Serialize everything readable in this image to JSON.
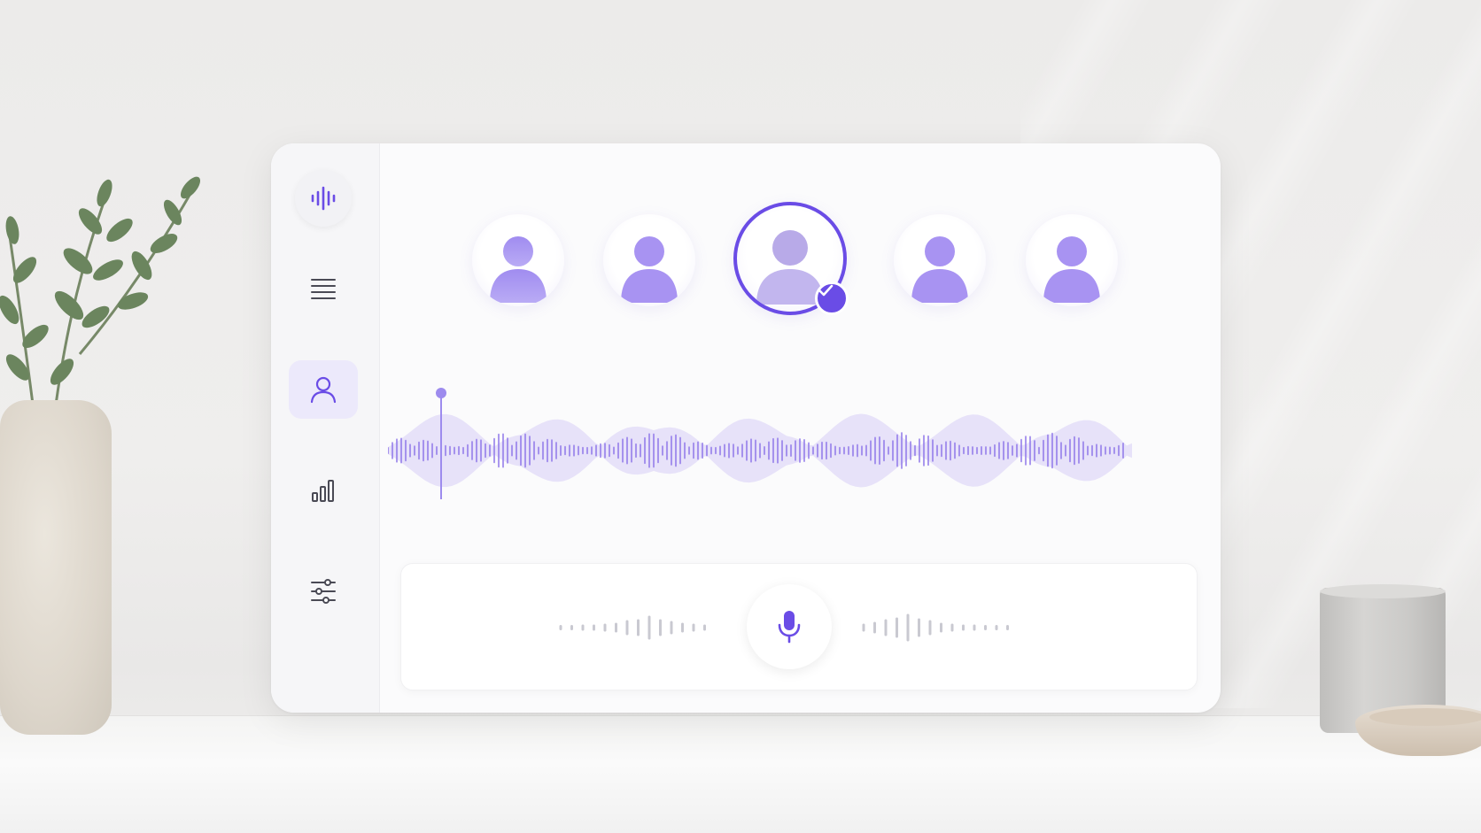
{
  "theme": {
    "accent": "#6a4ce6",
    "accent_light": "#a896f0",
    "icon_gray": "#4a4a55"
  },
  "sidebar": {
    "items": [
      {
        "name": "audio-waveform-logo",
        "icon": "waveform-icon",
        "active": false
      },
      {
        "name": "list",
        "icon": "menu-lines-icon",
        "active": false
      },
      {
        "name": "voices",
        "icon": "user-icon",
        "active": true
      },
      {
        "name": "analytics",
        "icon": "bar-chart-icon",
        "active": false
      },
      {
        "name": "settings",
        "icon": "sliders-icon",
        "active": false
      }
    ]
  },
  "voices": {
    "avatars": [
      {
        "icon": "person-icon",
        "selected": false
      },
      {
        "icon": "person-icon",
        "selected": false
      },
      {
        "icon": "person-icon",
        "selected": true
      },
      {
        "icon": "person-icon",
        "selected": false
      },
      {
        "icon": "person-icon",
        "selected": false
      }
    ],
    "selected_badge_icon": "checkmark-icon"
  },
  "waveform": {
    "playhead_icon": "playhead-marker"
  },
  "recorder": {
    "button_icon": "microphone-icon"
  }
}
